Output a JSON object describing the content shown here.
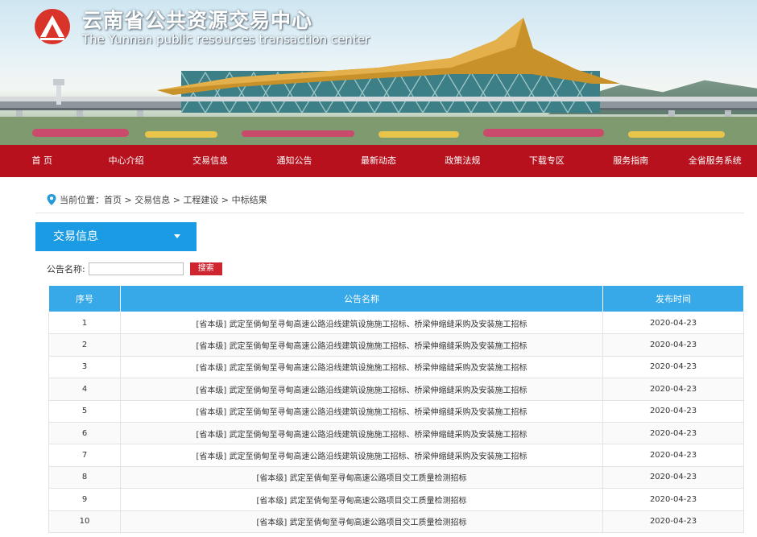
{
  "header": {
    "title": "云南省公共资源交易中心",
    "subtitle": "The Yunnan public resources transaction center",
    "logo_icon": "logo-mark-icon"
  },
  "nav": {
    "items": [
      {
        "label": "首 页"
      },
      {
        "label": "中心介绍"
      },
      {
        "label": "交易信息"
      },
      {
        "label": "通知公告"
      },
      {
        "label": "最新动态"
      },
      {
        "label": "政策法规"
      },
      {
        "label": "下载专区"
      },
      {
        "label": "服务指南"
      },
      {
        "label": "全省服务系统"
      }
    ]
  },
  "breadcrumb": {
    "icon": "location-pin-icon",
    "prefix": "当前位置：",
    "items": [
      "首页",
      "交易信息",
      "工程建设",
      "中标结果"
    ],
    "separator": " > "
  },
  "sidebar": {
    "label": "交易信息"
  },
  "search": {
    "label": "公告名称:",
    "value": "",
    "placeholder": "",
    "button_label": "搜索"
  },
  "table": {
    "headers": [
      "序号",
      "公告名称",
      "发布时间"
    ],
    "rows": [
      {
        "index": "1",
        "name": "[省本级] 武定至倘甸至寻甸高速公路沿线建筑设施施工招标、桥梁伸缩缝采购及安装施工招标",
        "date": "2020-04-23"
      },
      {
        "index": "2",
        "name": "[省本级] 武定至倘甸至寻甸高速公路沿线建筑设施施工招标、桥梁伸缩缝采购及安装施工招标",
        "date": "2020-04-23"
      },
      {
        "index": "3",
        "name": "[省本级] 武定至倘甸至寻甸高速公路沿线建筑设施施工招标、桥梁伸缩缝采购及安装施工招标",
        "date": "2020-04-23"
      },
      {
        "index": "4",
        "name": "[省本级] 武定至倘甸至寻甸高速公路沿线建筑设施施工招标、桥梁伸缩缝采购及安装施工招标",
        "date": "2020-04-23"
      },
      {
        "index": "5",
        "name": "[省本级] 武定至倘甸至寻甸高速公路沿线建筑设施施工招标、桥梁伸缩缝采购及安装施工招标",
        "date": "2020-04-23"
      },
      {
        "index": "6",
        "name": "[省本级] 武定至倘甸至寻甸高速公路沿线建筑设施施工招标、桥梁伸缩缝采购及安装施工招标",
        "date": "2020-04-23"
      },
      {
        "index": "7",
        "name": "[省本级] 武定至倘甸至寻甸高速公路沿线建筑设施施工招标、桥梁伸缩缝采购及安装施工招标",
        "date": "2020-04-23"
      },
      {
        "index": "8",
        "name": "[省本级] 武定至倘甸至寻甸高速公路项目交工质量检测招标",
        "date": "2020-04-23"
      },
      {
        "index": "9",
        "name": "[省本级] 武定至倘甸至寻甸高速公路项目交工质量检测招标",
        "date": "2020-04-23"
      },
      {
        "index": "10",
        "name": "[省本级] 武定至倘甸至寻甸高速公路项目交工质量检测招标",
        "date": "2020-04-23"
      }
    ]
  },
  "colors": {
    "nav_background": "#b6111d",
    "accent_blue": "#1a9be4",
    "table_header": "#38a9e8",
    "search_button": "#d02430"
  }
}
